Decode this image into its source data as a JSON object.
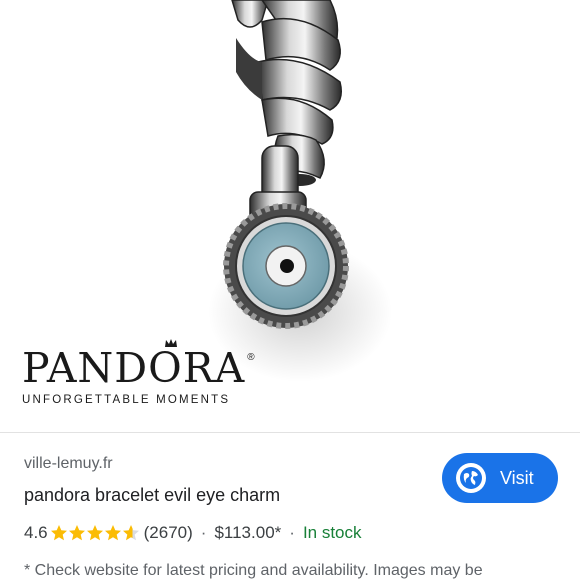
{
  "product_image": {
    "brand_logo": "PANDORA",
    "brand_registered": "®",
    "brand_tagline": "UNFORGETTABLE MOMENTS"
  },
  "result": {
    "source": "ville-lemuy.fr",
    "title": "pandora bracelet evil eye charm",
    "rating": "4.6",
    "rating_value": 4.6,
    "rating_max": 5,
    "review_count": "(2670)",
    "separator": "·",
    "price": "$113.00*",
    "availability": "In stock",
    "disclaimer": "* Check website for latest pricing and availability. Images may be",
    "visit_label": "Visit",
    "visit_icon": "globe-icon"
  },
  "colors": {
    "accent": "#1a73e8",
    "star": "#fbbc04",
    "in_stock": "#188038"
  }
}
